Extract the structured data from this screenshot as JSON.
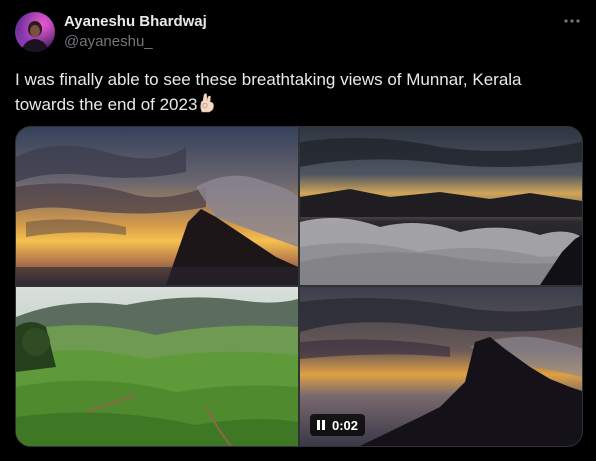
{
  "author": {
    "display_name": "Ayaneshu Bhardwaj",
    "handle": "@ayaneshu_",
    "avatar_icon": "profile-avatar"
  },
  "tweet": {
    "text": "I was finally able to see these breathtaking views of Munnar, Kerala\ntowards the end of 2023",
    "emoji_icon": "ok-hand-emoji"
  },
  "menu": {
    "icon": "more-horizontal-icon"
  },
  "media": {
    "video": {
      "time": "0:02",
      "control_icon": "pause-icon"
    }
  },
  "colors": {
    "background": "#000000",
    "primary_text": "#e7e9ea",
    "secondary_text": "#71767b",
    "border": "#2f3336"
  }
}
